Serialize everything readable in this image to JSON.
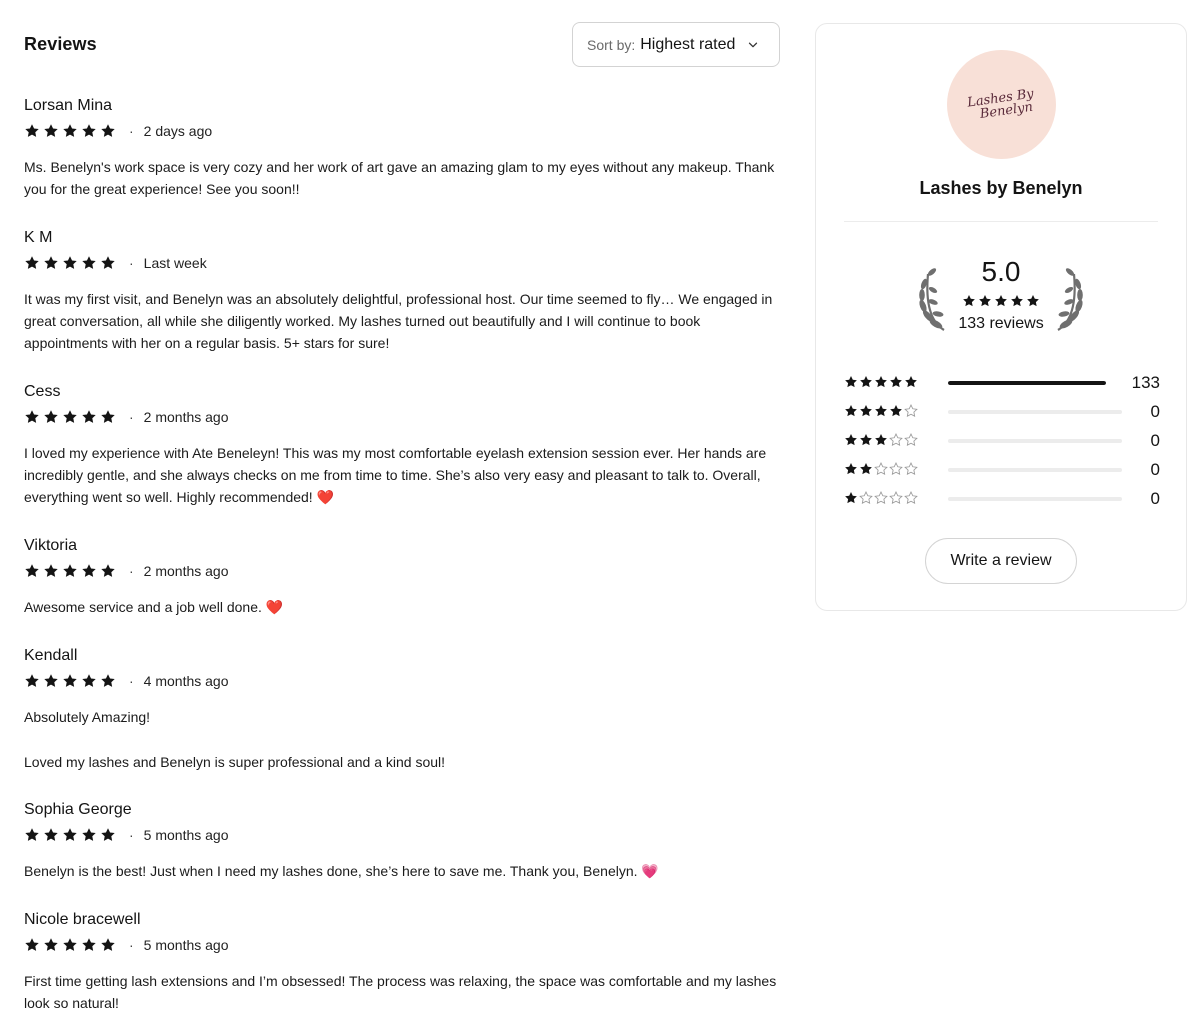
{
  "header": {
    "title": "Reviews",
    "sort_prefix": "Sort by:",
    "sort_value": "Highest rated"
  },
  "reviews": [
    {
      "name": "Lorsan Mina",
      "rating": 5,
      "time": "2 days ago",
      "body": [
        "Ms. Benelyn's work space is very cozy and her work of art gave an amazing glam to my eyes without any makeup. Thank you for the great experience! See you soon!!"
      ]
    },
    {
      "name": "K M",
      "rating": 5,
      "time": "Last week",
      "body": [
        "It was my first visit, and Benelyn was an absolutely delightful, professional host. Our time seemed to fly… We engaged in great conversation, all while she diligently worked. My lashes turned out beautifully and I will continue to book appointments with her on a regular basis. 5+ stars for sure!"
      ]
    },
    {
      "name": "Cess",
      "rating": 5,
      "time": "2 months ago",
      "body": [
        "I loved my experience with Ate Beneleyn! This was my most comfortable eyelash extension session ever. Her hands are incredibly gentle, and she always checks on me from time to time. She’s also very easy and pleasant to talk to. Overall, everything went so well. Highly recommended! ❤️"
      ]
    },
    {
      "name": "Viktoria",
      "rating": 5,
      "time": "2 months ago",
      "body": [
        "Awesome service and a job well done. ❤️"
      ]
    },
    {
      "name": "Kendall",
      "rating": 5,
      "time": "4 months ago",
      "body": [
        "Absolutely Amazing!",
        "Loved my lashes and Benelyn is super professional and a kind soul!"
      ]
    },
    {
      "name": "Sophia George",
      "rating": 5,
      "time": "5 months ago",
      "body": [
        "Benelyn is the best! Just when I need my lashes done, she’s here to save me. Thank you, Benelyn. 💗"
      ]
    },
    {
      "name": "Nicole bracewell",
      "rating": 5,
      "time": "5 months ago",
      "body": [
        "First time getting lash extensions and I’m obsessed! The process was relaxing, the space was comfortable and my lashes look so natural!"
      ]
    }
  ],
  "summary": {
    "logo_text": "Lashes By Benelyn",
    "business_name": "Lashes by Benelyn",
    "rating": "5.0",
    "rating_stars": 5,
    "total_reviews": "133 reviews",
    "distribution": [
      {
        "stars": 5,
        "count": "133",
        "fraction": 1.0
      },
      {
        "stars": 4,
        "count": "0",
        "fraction": 0
      },
      {
        "stars": 3,
        "count": "0",
        "fraction": 0
      },
      {
        "stars": 2,
        "count": "0",
        "fraction": 0
      },
      {
        "stars": 1,
        "count": "0",
        "fraction": 0
      }
    ],
    "write_review_label": "Write a review"
  },
  "colors": {
    "star": "#141414",
    "bar_fill": "#141414",
    "bar_track": "#ececec",
    "logo_bg": "#f8e0d7",
    "laurel": "#7a7a7a"
  },
  "icons": {
    "star_filled": "star-icon",
    "star_empty": "star-outline-icon",
    "sort_chevron": "chevron-down-icon",
    "laurel": "laurel-icon"
  }
}
